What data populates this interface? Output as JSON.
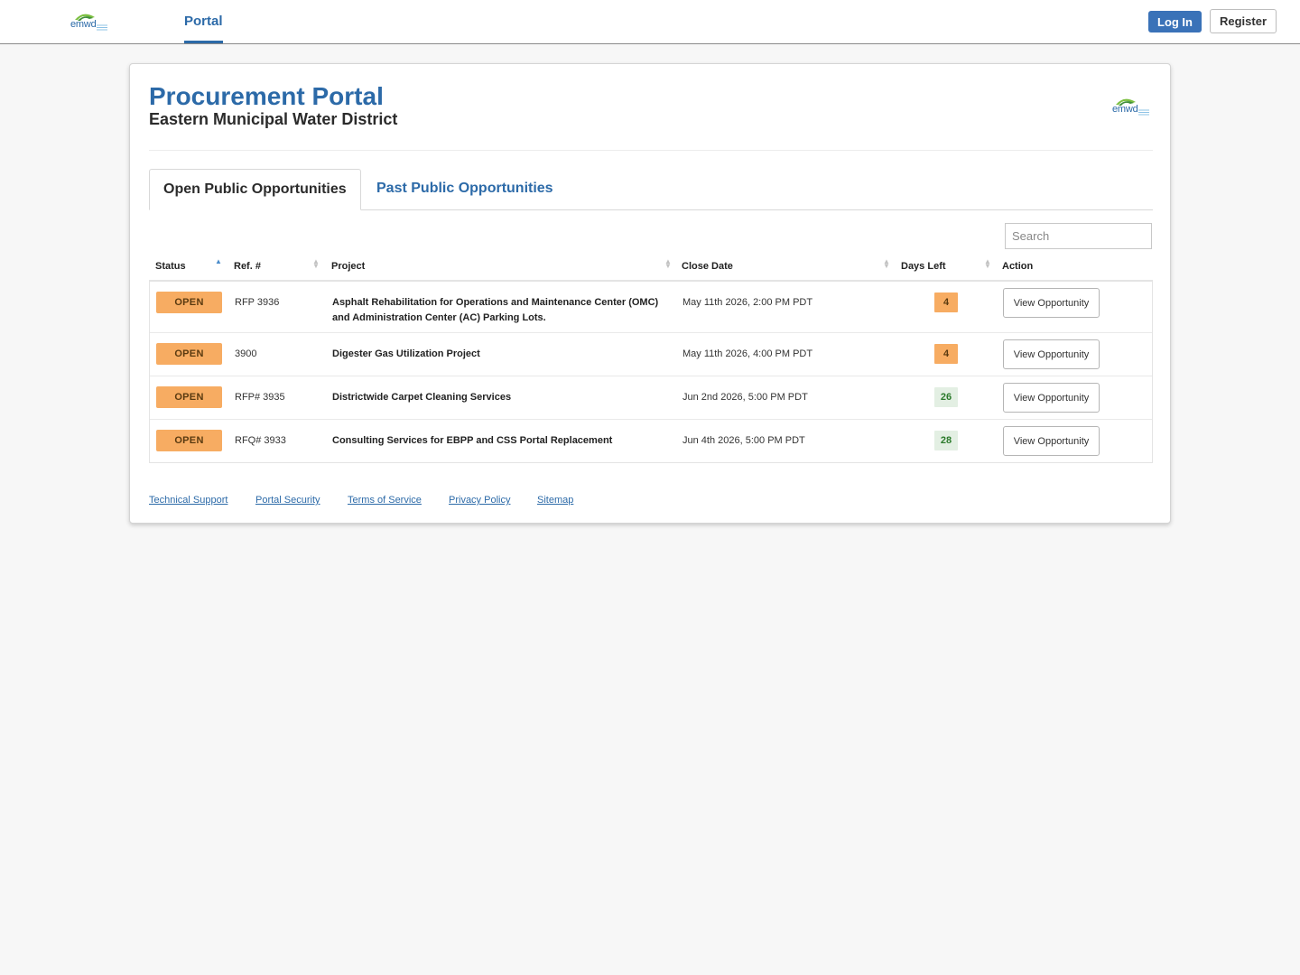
{
  "nav": {
    "logo_text": "emwd",
    "tab_portal": "Portal",
    "login_label": "Log In",
    "register_label": "Register"
  },
  "header": {
    "title": "Procurement Portal",
    "subtitle": "Eastern Municipal Water District",
    "logo_text": "emwd"
  },
  "tabs": {
    "open": "Open Public Opportunities",
    "past": "Past Public Opportunities"
  },
  "search": {
    "placeholder": "Search"
  },
  "table": {
    "columns": [
      "Status",
      "Ref. #",
      "Project",
      "Close Date",
      "Days Left",
      "Action"
    ],
    "rows": [
      {
        "status": "OPEN",
        "ref": "RFP 3936",
        "project": "Asphalt Rehabilitation for Operations and Maintenance Center (OMC) and Administration Center (AC) Parking Lots.",
        "close_date": "May 11th 2026, 2:00 PM PDT",
        "days_left": "4",
        "action": "View Opportunity"
      },
      {
        "status": "OPEN",
        "ref": "3900",
        "project": "Digester Gas Utilization Project",
        "close_date": "May 11th 2026, 4:00 PM PDT",
        "days_left": "4",
        "action": "View Opportunity"
      },
      {
        "status": "OPEN",
        "ref": "RFP# 3935",
        "project": "Districtwide Carpet Cleaning Services",
        "close_date": "Jun 2nd 2026, 5:00 PM PDT",
        "days_left": "26",
        "action": "View Opportunity"
      },
      {
        "status": "OPEN",
        "ref": "RFQ# 3933",
        "project": "Consulting Services for EBPP and CSS Portal Replacement",
        "close_date": "Jun 4th 2026, 5:00 PM PDT",
        "days_left": "28",
        "action": "View Opportunity"
      }
    ]
  },
  "footer": {
    "links": [
      "Technical Support",
      "Portal Security",
      "Terms of Service",
      "Privacy Policy",
      "Sitemap"
    ]
  },
  "colors": {
    "brand_blue": "#2c6aa8",
    "login_blue": "#3a72b8",
    "badge_orange": "#f7ac62",
    "days_ok_bg": "#e3efe3",
    "days_ok_text": "#2b7a2b"
  }
}
